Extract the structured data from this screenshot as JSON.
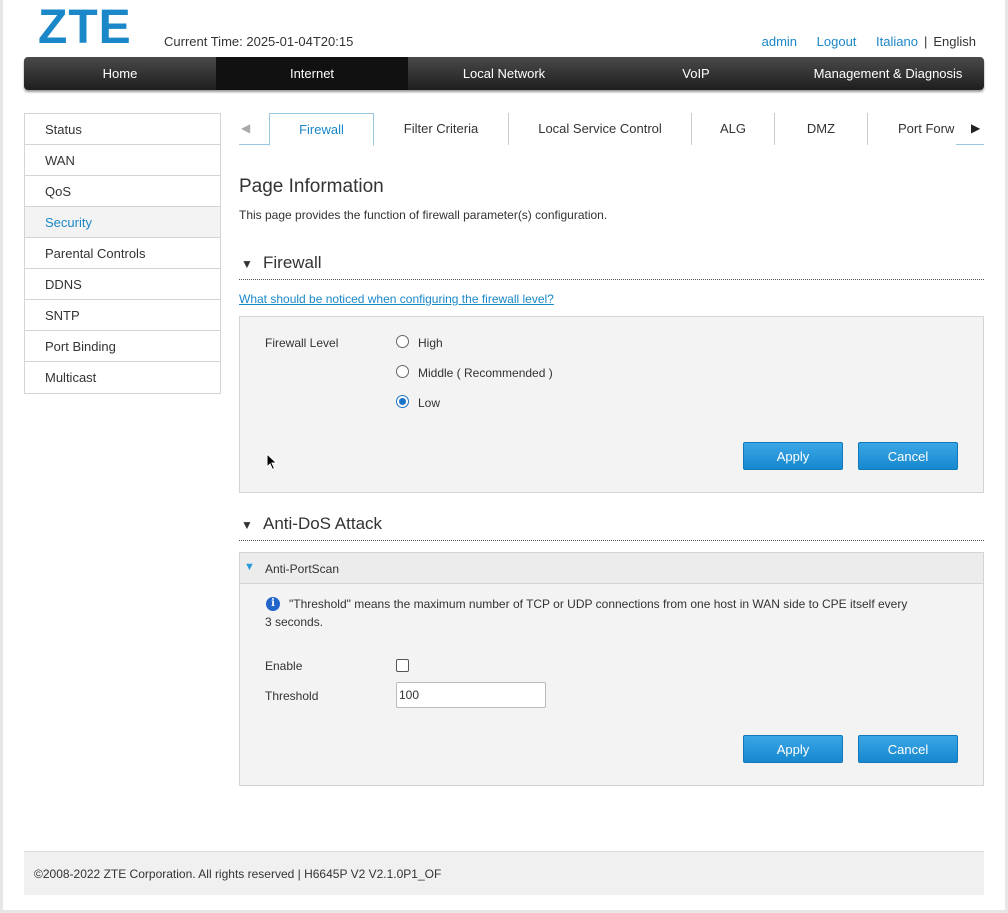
{
  "header": {
    "logo": "ZTE",
    "current_time_label": "Current Time: 2025-01-04T20:15",
    "user": "admin",
    "logout": "Logout",
    "lang_italiano": "Italiano",
    "lang_sep": "|",
    "lang_english": "English"
  },
  "nav": {
    "items": [
      "Home",
      "Internet",
      "Local Network",
      "VoIP",
      "Management & Diagnosis"
    ],
    "active": "Internet"
  },
  "sidebar": {
    "items": [
      "Status",
      "WAN",
      "QoS",
      "Security",
      "Parental Controls",
      "DDNS",
      "SNTP",
      "Port Binding",
      "Multicast"
    ],
    "active": "Security"
  },
  "tabs": {
    "items": [
      "Firewall",
      "Filter Criteria",
      "Local Service Control",
      "ALG",
      "DMZ",
      "Port Forw"
    ],
    "active": "Firewall",
    "left_arrow": "◀",
    "right_arrow": "▶"
  },
  "page_info": {
    "title": "Page Information",
    "description": "This page provides the function of firewall parameter(s) configuration."
  },
  "firewall": {
    "section_title": "Firewall",
    "notice_link": "What should be noticed when configuring the firewall level?",
    "level_label": "Firewall Level",
    "options": [
      "High",
      "Middle ( Recommended )",
      "Low"
    ],
    "selected": "Low",
    "apply": "Apply",
    "cancel": "Cancel"
  },
  "antidos": {
    "section_title": "Anti-DoS Attack",
    "sub_title": "Anti-PortScan",
    "info_line1": "\"Threshold\" means the maximum number of TCP or UDP connections from one host in WAN side to CPE itself every",
    "info_line2": "3 seconds.",
    "enable_label": "Enable",
    "enable_checked": false,
    "threshold_label": "Threshold",
    "threshold_value": "100",
    "apply": "Apply",
    "cancel": "Cancel"
  },
  "footer": {
    "text": "©2008-2022 ZTE Corporation. All rights reserved  |   H6645P V2 V2.1.0P1_OF"
  },
  "colors": {
    "accent": "#1a87c9",
    "button": "#1a8ed4",
    "nav_bg": "#2a2a2a"
  }
}
